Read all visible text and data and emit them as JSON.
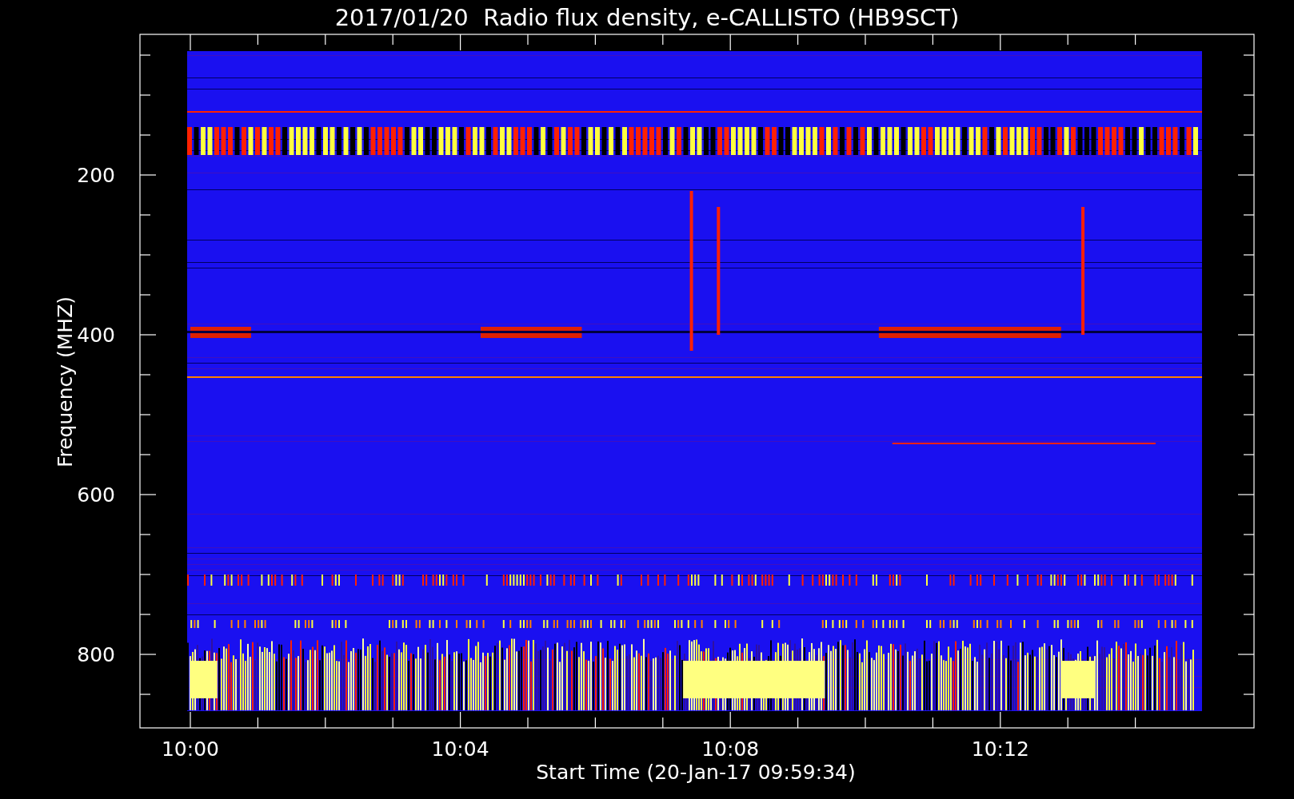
{
  "title": "2017/01/20  Radio flux density, e-CALLISTO (HB9SCT)",
  "plot": {
    "ylabel": "Frequency (MHZ)",
    "xlabel": "Start Time (20-Jan-17 09:59:34)",
    "yticks": [
      "200",
      "400",
      "600",
      "800"
    ],
    "xticks": [
      "10:00",
      "10:04",
      "10:08",
      "10:12"
    ]
  }
}
